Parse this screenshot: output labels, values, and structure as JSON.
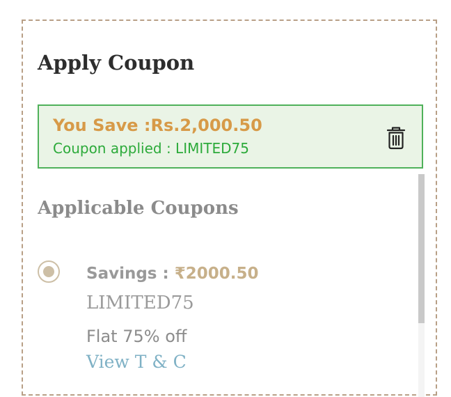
{
  "panel": {
    "title": "Apply Coupon"
  },
  "applied": {
    "save_text": "You Save :Rs.2,000.50",
    "applied_text": "Coupon applied : LIMITED75",
    "remove_icon": "trash-icon"
  },
  "applicable": {
    "title": "Applicable Coupons",
    "coupons": [
      {
        "savings_label": "Savings : ",
        "savings_value": "₹2000.50",
        "code": "LIMITED75",
        "description": "Flat 75% off",
        "tc_link": "View T & C",
        "selected": true
      }
    ]
  },
  "colors": {
    "border": "#b89f86",
    "applied_bg": "#eaf4e6",
    "applied_border": "#4fb15a",
    "save_text": "#d79a48",
    "success_text": "#2caa3a",
    "muted_text": "#8b8b8b",
    "savings_value": "#c7b08a",
    "link": "#7fb1c5",
    "radio": "#cdbfa6"
  }
}
